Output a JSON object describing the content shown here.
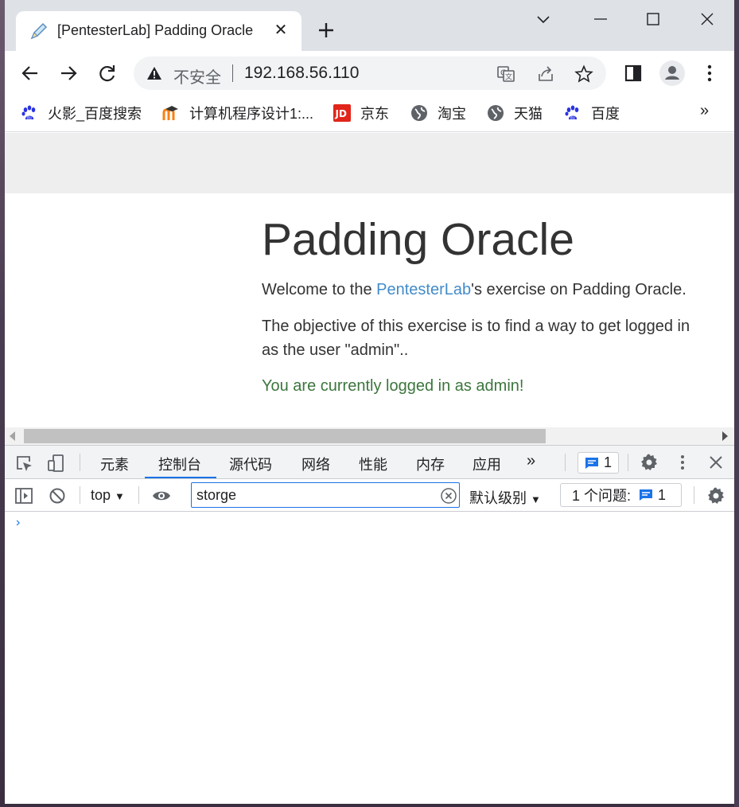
{
  "browser": {
    "tab": {
      "title": "[PentesterLab] Padding Oracle",
      "close": "✕"
    },
    "new_tab": "+",
    "omnibox": {
      "security_label": "不安全",
      "url": "192.168.56.110"
    },
    "bookmarks": [
      {
        "label": "火影_百度搜索",
        "icon": "baidu-paw-icon"
      },
      {
        "label": "计算机程序设计1:...",
        "icon": "moodle-icon"
      },
      {
        "label": "京东",
        "icon": "jd-icon"
      },
      {
        "label": "淘宝",
        "icon": "globe-icon"
      },
      {
        "label": "天猫",
        "icon": "globe-icon"
      },
      {
        "label": "百度",
        "icon": "baidu-paw-icon"
      }
    ],
    "bookmarks_more": "»"
  },
  "page": {
    "heading": "Padding Oracle",
    "welcome_prefix": "Welcome to the ",
    "welcome_link": "PentesterLab",
    "welcome_suffix": "'s exercise on Padding Oracle.",
    "objective_line1": "The objective of this exercise is to find a way to get logged in",
    "objective_line2": "as the user \"admin\"..",
    "success": "You are currently logged in as admin!"
  },
  "devtools": {
    "tabs": [
      "元素",
      "控制台",
      "源代码",
      "网络",
      "性能",
      "内存",
      "应用"
    ],
    "active_tab": "控制台",
    "more_tabs": "»",
    "issue_count": "1",
    "context": "top",
    "filter_value": "storge",
    "level": "默认级别",
    "issues_label": "1 个问题:",
    "issues_count": "1",
    "prompt": "›"
  },
  "colors": {
    "link": "#428bca",
    "success": "#3c763d",
    "accent": "#1a73e8"
  }
}
